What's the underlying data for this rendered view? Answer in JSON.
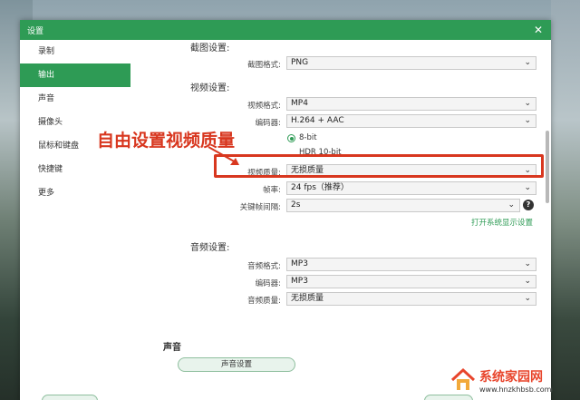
{
  "window": {
    "title": "设置",
    "close": "✕"
  },
  "sidebar": {
    "items": [
      {
        "label": "录制",
        "active": false
      },
      {
        "label": "输出",
        "active": true
      },
      {
        "label": "声音",
        "active": false
      },
      {
        "label": "摄像头",
        "active": false
      },
      {
        "label": "鼠标和键盘",
        "active": false
      },
      {
        "label": "快捷键",
        "active": false
      },
      {
        "label": "更多",
        "active": false
      }
    ]
  },
  "screenshot_settings": {
    "title": "截图设置:",
    "format_label": "截图格式:",
    "format_value": "PNG"
  },
  "video_settings": {
    "title": "视频设置:",
    "format_label": "视频格式:",
    "format_value": "MP4",
    "encoder_label": "编码器:",
    "encoder_value": "H.264 + AAC",
    "bitdepth_options": [
      "8-bit",
      "HDR 10-bit"
    ],
    "bitdepth_selected": "8-bit",
    "quality_label": "视频质量:",
    "quality_value": "无损质量",
    "framerate_label": "帧率:",
    "framerate_value": "24 fps（推荐）",
    "keyframe_label": "关键帧间隔:",
    "keyframe_value": "2s",
    "help": "?",
    "display_link": "打开系统显示设置"
  },
  "audio_settings": {
    "title": "音频设置:",
    "format_label": "音频格式:",
    "format_value": "MP3",
    "encoder_label": "编码器:",
    "encoder_value": "MP3",
    "quality_label": "音频质量:",
    "quality_value": "无损质量"
  },
  "sound": {
    "title": "声音",
    "button": "声音设置"
  },
  "annotation": {
    "text": "自由设置视频质量",
    "color": "#d8371f"
  },
  "watermark": {
    "title": "系统家园网",
    "url": "www.hnzkhbsb.com"
  },
  "colors": {
    "accent": "#2e9b55"
  }
}
